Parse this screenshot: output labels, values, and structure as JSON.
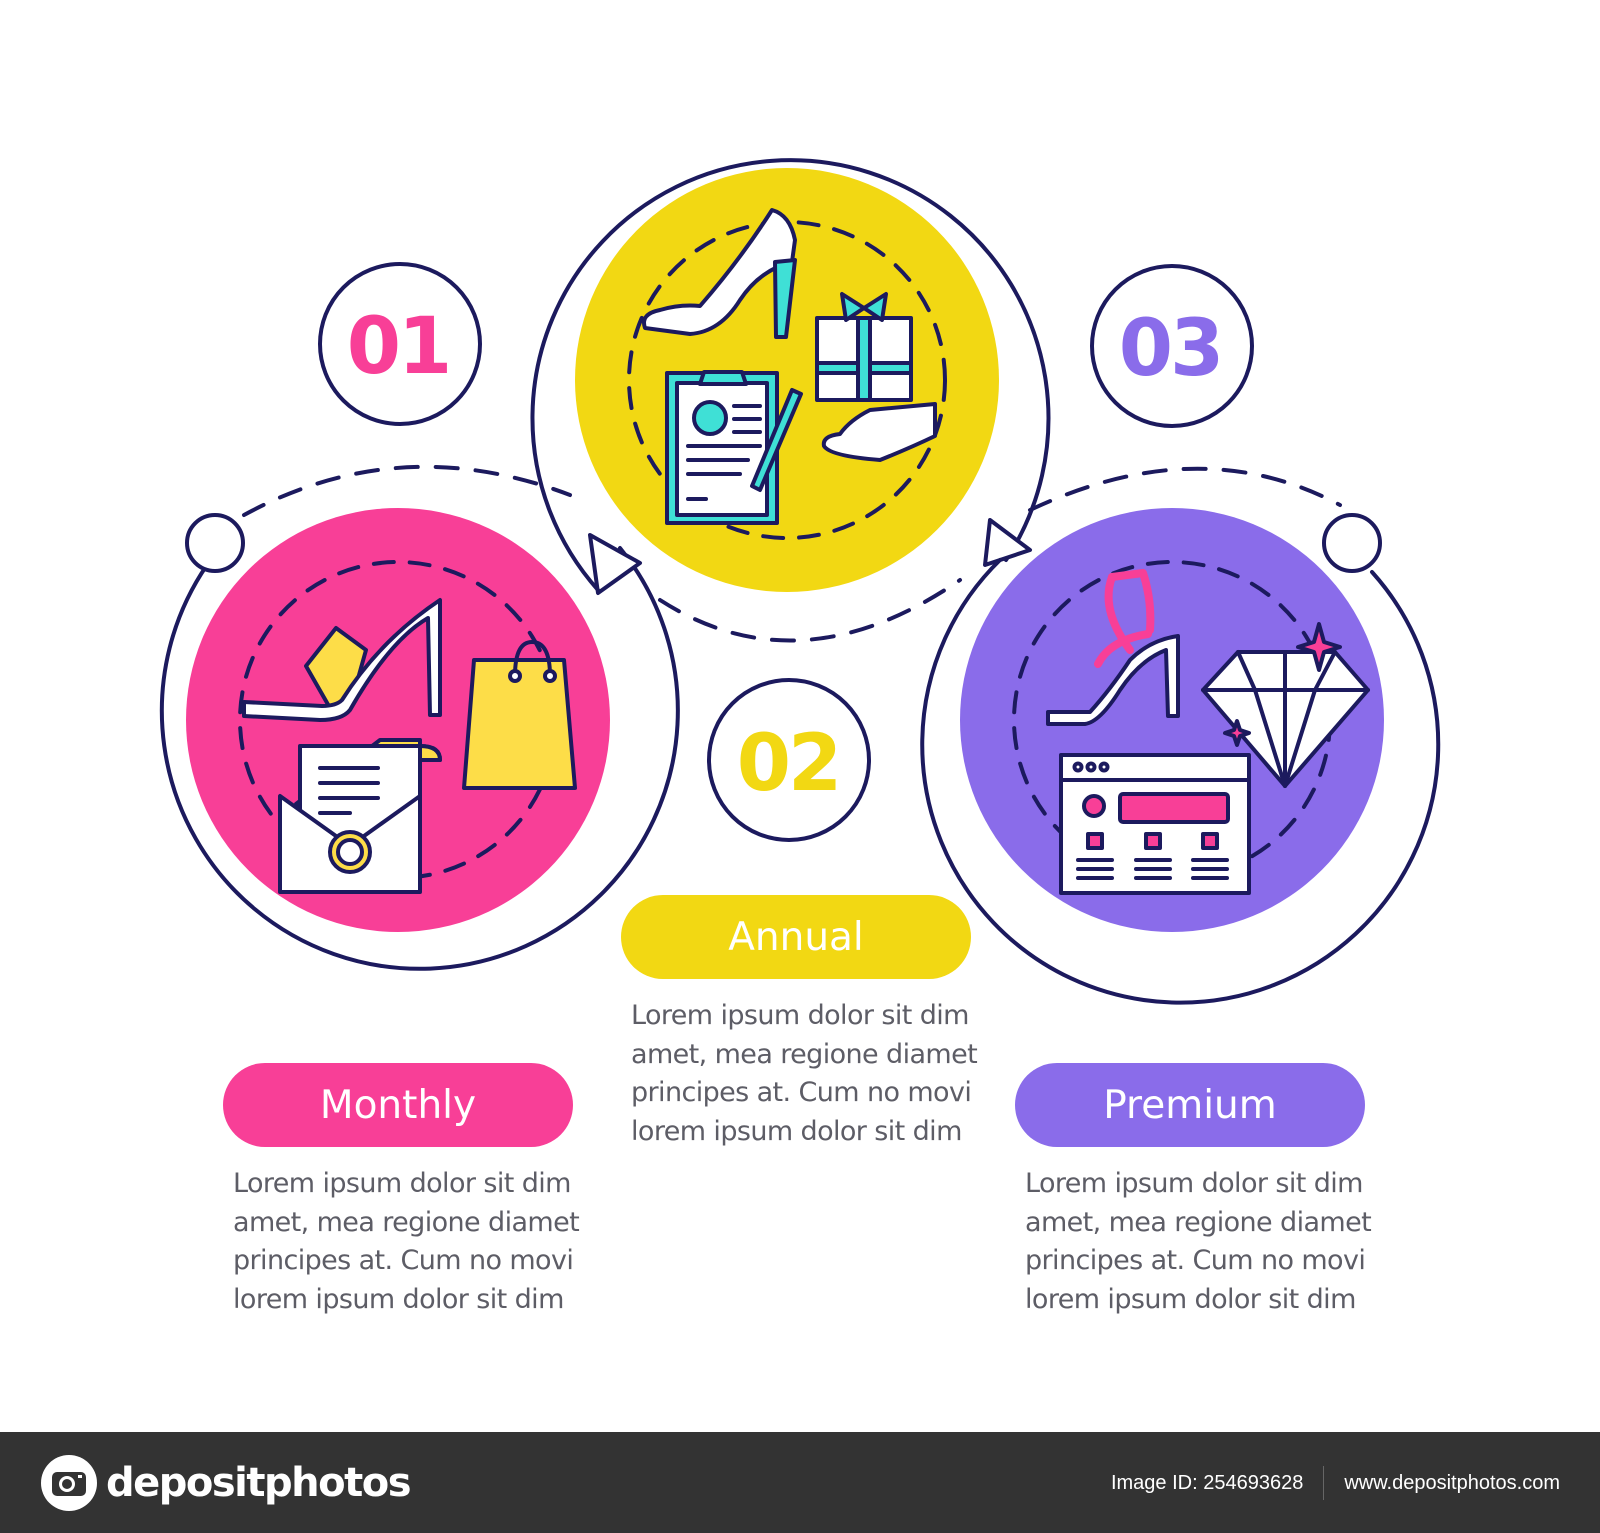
{
  "theme": {
    "outline": "#1c1a5e",
    "pink": "#f83f97",
    "yellow": "#f2d813",
    "purple": "#8a6cea",
    "teal": "#3fe0d6",
    "light_yellow": "#fddd48",
    "text_gray": "#5d5d66"
  },
  "steps": [
    {
      "number": "01",
      "label": "Monthly",
      "color": "#f83f97",
      "icons": [
        "sandal-shoe-icon",
        "shopping-bag-icon",
        "envelope-letter-icon"
      ],
      "description": [
        "Lorem ipsum dolor sit dim",
        "amet, mea regione diamet",
        "principes at. Cum no movi",
        "lorem ipsum dolor sit dim"
      ]
    },
    {
      "number": "02",
      "label": "Annual",
      "color": "#f2d813",
      "icons": [
        "high-heel-shoe-icon",
        "gift-box-icon",
        "clipboard-contract-icon",
        "open-hand-icon"
      ],
      "description": [
        "Lorem ipsum dolor sit dim",
        "amet, mea regione diamet",
        "principes at. Cum no movi",
        "lorem ipsum dolor sit dim"
      ]
    },
    {
      "number": "03",
      "label": "Premium",
      "color": "#8a6cea",
      "icons": [
        "strappy-heel-icon",
        "diamond-icon",
        "web-page-icon"
      ],
      "description": [
        "Lorem ipsum dolor sit dim",
        "amet, mea regione diamet",
        "principes at. Cum no movi",
        "lorem ipsum dolor sit dim"
      ]
    }
  ],
  "footer": {
    "brand": "depositphotos",
    "image_id": "Image ID: 254693628",
    "website": "www.depositphotos.com"
  }
}
